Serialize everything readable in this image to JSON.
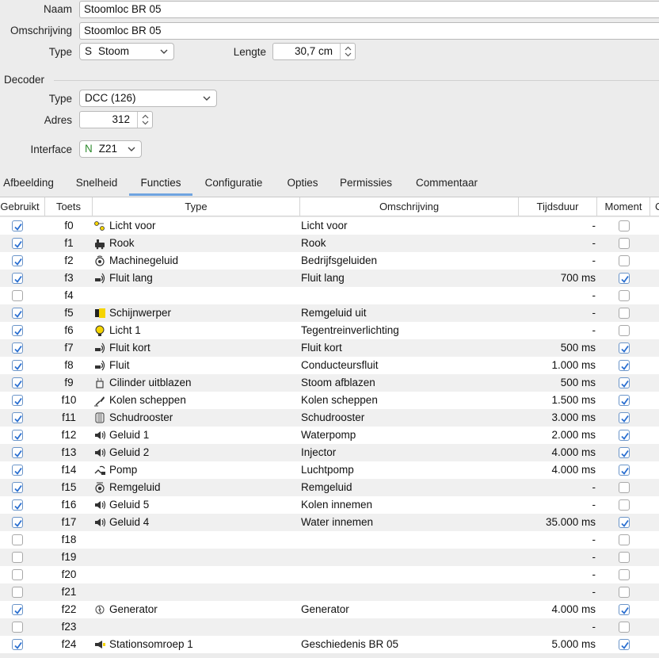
{
  "form": {
    "naam_label": "Naam",
    "naam_value": "Stoomloc BR 05",
    "omschrijving_label": "Omschrijving",
    "omschrijving_value": "Stoomloc BR 05",
    "type_label": "Type",
    "type_prefix": "S",
    "type_value": "Stoom",
    "lengte_label": "Lengte",
    "lengte_value": "30,7 cm"
  },
  "decoder": {
    "section_title": "Decoder",
    "type_label": "Type",
    "type_value": "DCC (126)",
    "adres_label": "Adres",
    "adres_value": "312",
    "interface_label": "Interface",
    "interface_prefix": "N",
    "interface_value": "Z21"
  },
  "tabs": [
    "Afbeelding",
    "Snelheid",
    "Functies",
    "Configuratie",
    "Opties",
    "Permissies",
    "Commentaar"
  ],
  "active_tab": "Functies",
  "columns": {
    "gebruikt": "Gebruikt",
    "toets": "Toets",
    "type": "Type",
    "omschrijving": "Omschrijving",
    "tijdsduur": "Tijdsduur",
    "moment": "Moment",
    "extra": "C"
  },
  "colors": {
    "accent": "#6fa4e0",
    "check": "#2a6fd1",
    "interface_prefix": "#2e8b2e"
  },
  "rows": [
    {
      "used": true,
      "key": "f0",
      "icon": "lights-icon",
      "type": "Licht voor",
      "desc": "Licht voor",
      "dur": "-",
      "moment": false
    },
    {
      "used": true,
      "key": "f1",
      "icon": "smoke-icon",
      "type": "Rook",
      "desc": "Rook",
      "dur": "-",
      "moment": false
    },
    {
      "used": true,
      "key": "f2",
      "icon": "engine-sound-icon",
      "type": "Machinegeluid",
      "desc": "Bedrijfsgeluiden",
      "dur": "-",
      "moment": false
    },
    {
      "used": true,
      "key": "f3",
      "icon": "whistle-icon",
      "type": "Fluit lang",
      "desc": "Fluit lang",
      "dur": "700 ms",
      "moment": true
    },
    {
      "used": false,
      "key": "f4",
      "icon": "",
      "type": "",
      "desc": "",
      "dur": "-",
      "moment": false
    },
    {
      "used": true,
      "key": "f5",
      "icon": "spotlight-icon",
      "type": "Schijnwerper",
      "desc": "Remgeluid uit",
      "dur": "-",
      "moment": false
    },
    {
      "used": true,
      "key": "f6",
      "icon": "bulb-icon",
      "type": "Licht 1",
      "desc": "Tegentreinverlichting",
      "dur": "-",
      "moment": false
    },
    {
      "used": true,
      "key": "f7",
      "icon": "whistle-icon",
      "type": "Fluit kort",
      "desc": "Fluit kort",
      "dur": "500 ms",
      "moment": true
    },
    {
      "used": true,
      "key": "f8",
      "icon": "whistle-icon",
      "type": "Fluit",
      "desc": "Conducteursfluit",
      "dur": "1.000 ms",
      "moment": true
    },
    {
      "used": true,
      "key": "f9",
      "icon": "cylinder-icon",
      "type": "Cilinder uitblazen",
      "desc": "Stoom afblazen",
      "dur": "500 ms",
      "moment": true
    },
    {
      "used": true,
      "key": "f10",
      "icon": "shovel-icon",
      "type": "Kolen scheppen",
      "desc": "Kolen scheppen",
      "dur": "1.500 ms",
      "moment": true
    },
    {
      "used": true,
      "key": "f11",
      "icon": "grate-icon",
      "type": "Schudrooster",
      "desc": "Schudrooster",
      "dur": "3.000 ms",
      "moment": true
    },
    {
      "used": true,
      "key": "f12",
      "icon": "speaker-icon",
      "type": "Geluid 1",
      "desc": "Waterpomp",
      "dur": "2.000 ms",
      "moment": true
    },
    {
      "used": true,
      "key": "f13",
      "icon": "speaker-icon",
      "type": "Geluid 2",
      "desc": "Injector",
      "dur": "4.000 ms",
      "moment": true
    },
    {
      "used": true,
      "key": "f14",
      "icon": "pump-icon",
      "type": "Pomp",
      "desc": "Luchtpomp",
      "dur": "4.000 ms",
      "moment": true
    },
    {
      "used": true,
      "key": "f15",
      "icon": "brake-icon",
      "type": "Remgeluid",
      "desc": "Remgeluid",
      "dur": "-",
      "moment": false
    },
    {
      "used": true,
      "key": "f16",
      "icon": "speaker-icon",
      "type": "Geluid 5",
      "desc": "Kolen innemen",
      "dur": "-",
      "moment": false
    },
    {
      "used": true,
      "key": "f17",
      "icon": "speaker-icon",
      "type": "Geluid 4",
      "desc": "Water innemen",
      "dur": "35.000 ms",
      "moment": true
    },
    {
      "used": false,
      "key": "f18",
      "icon": "",
      "type": "",
      "desc": "",
      "dur": "-",
      "moment": false
    },
    {
      "used": false,
      "key": "f19",
      "icon": "",
      "type": "",
      "desc": "",
      "dur": "-",
      "moment": false
    },
    {
      "used": false,
      "key": "f20",
      "icon": "",
      "type": "",
      "desc": "",
      "dur": "-",
      "moment": false
    },
    {
      "used": false,
      "key": "f21",
      "icon": "",
      "type": "",
      "desc": "",
      "dur": "-",
      "moment": false
    },
    {
      "used": true,
      "key": "f22",
      "icon": "generator-icon",
      "type": "Generator",
      "desc": "Generator",
      "dur": "4.000 ms",
      "moment": true
    },
    {
      "used": false,
      "key": "f23",
      "icon": "",
      "type": "",
      "desc": "",
      "dur": "-",
      "moment": false
    },
    {
      "used": true,
      "key": "f24",
      "icon": "announcement-icon",
      "type": "Stationsomroep 1",
      "desc": "Geschiedenis BR 05",
      "dur": "5.000 ms",
      "moment": true
    }
  ]
}
